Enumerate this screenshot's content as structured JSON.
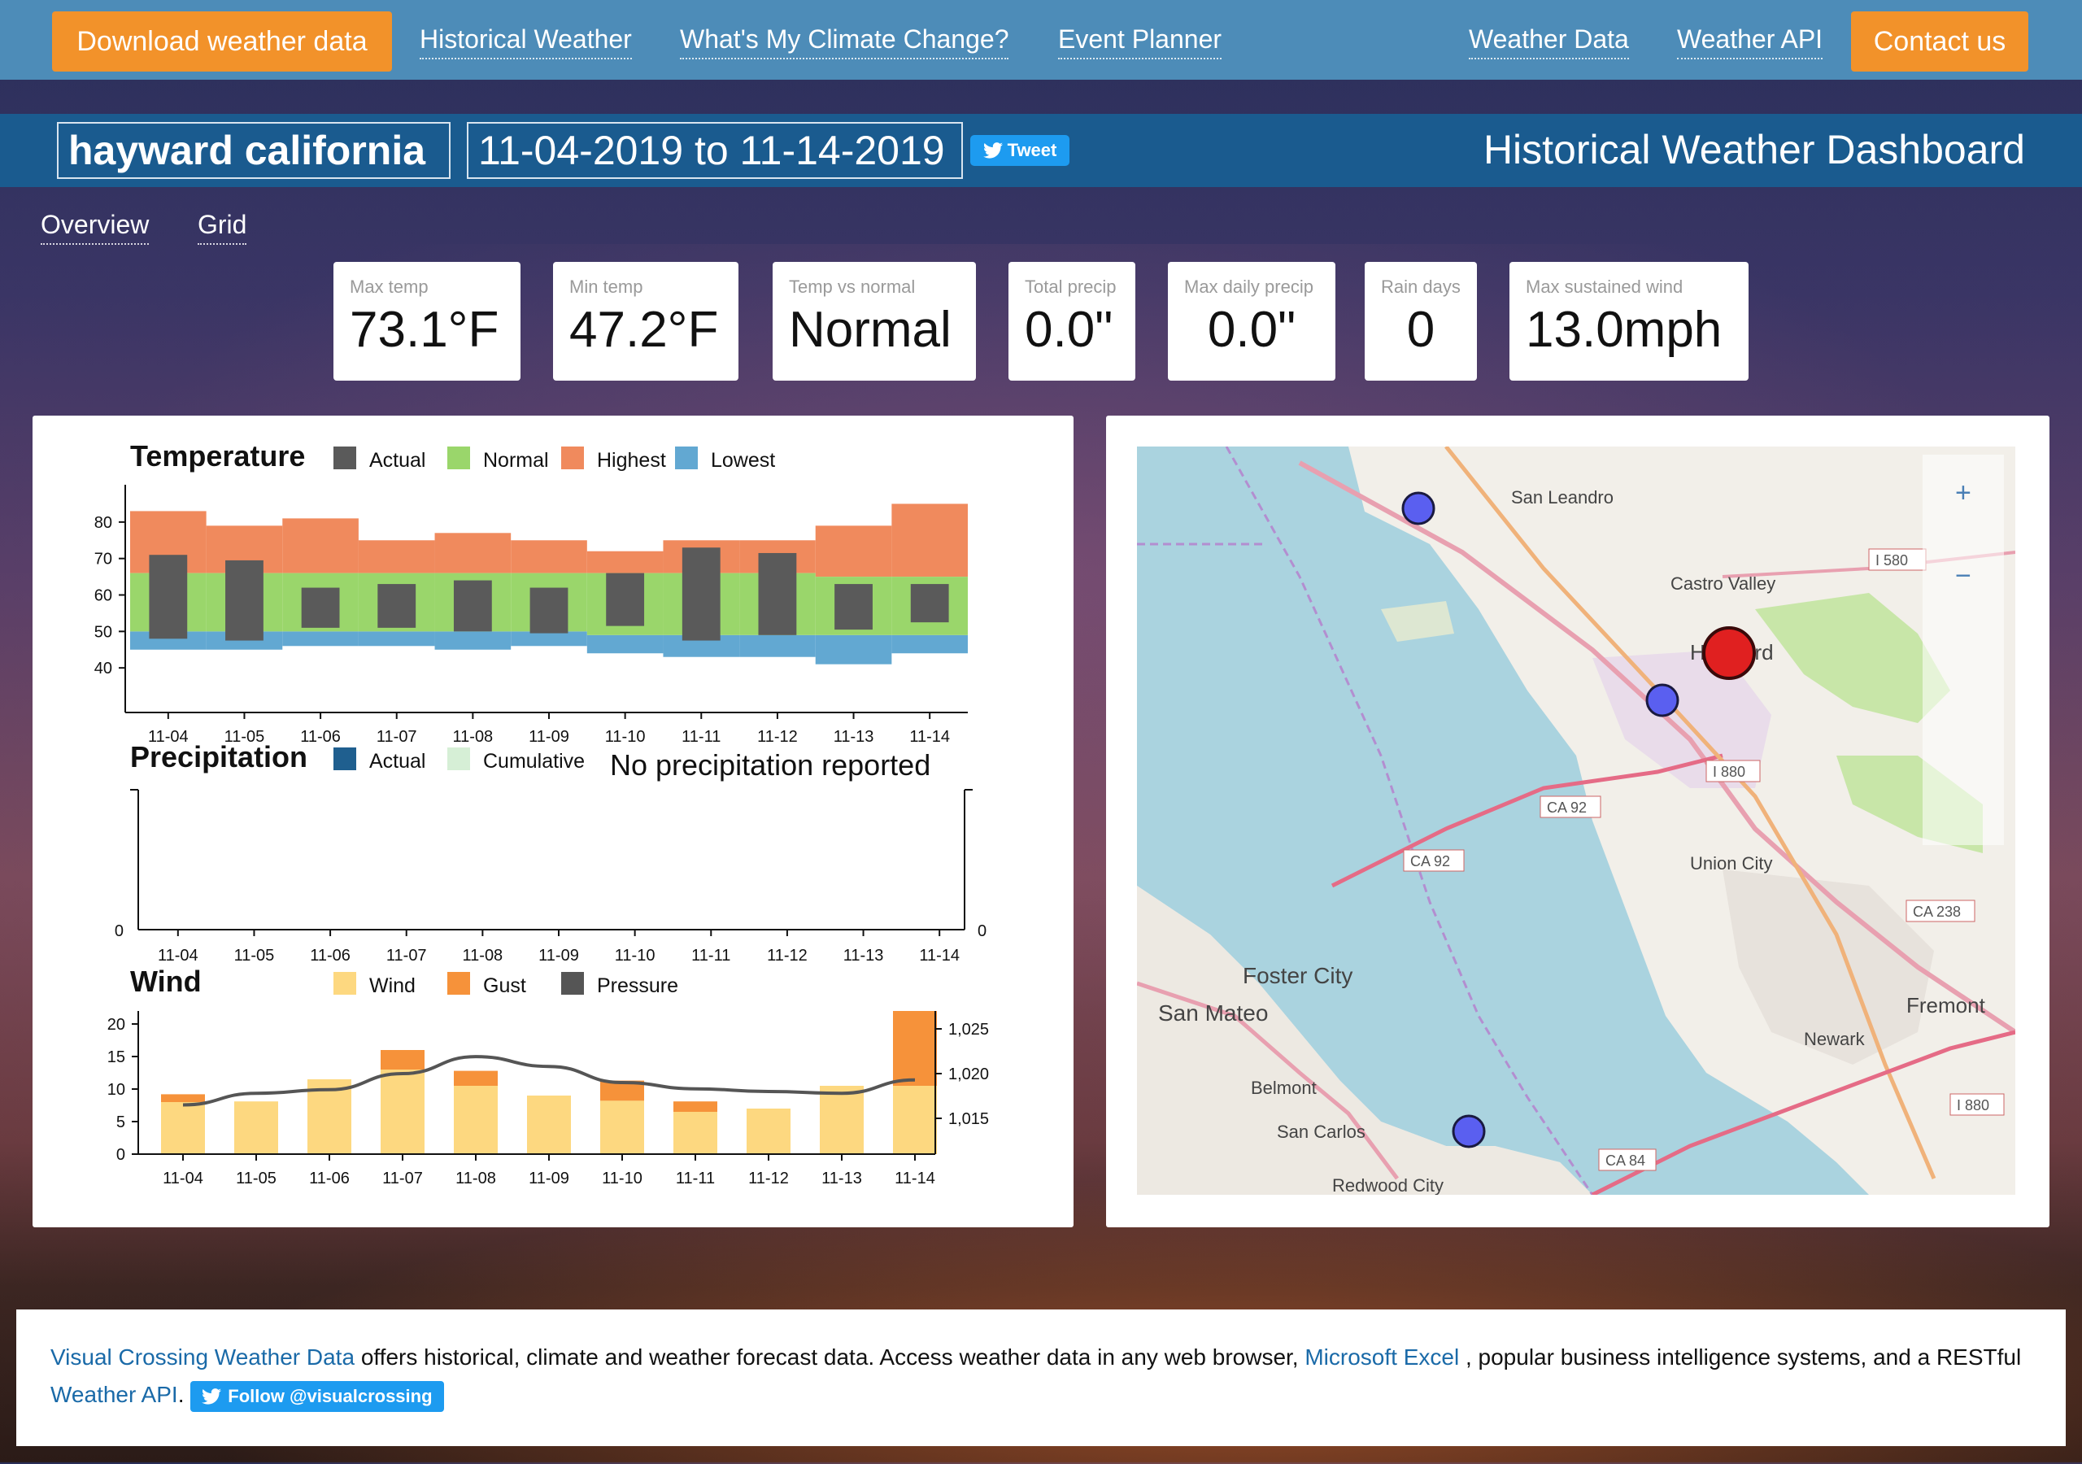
{
  "nav": {
    "download_btn": "Download weather data",
    "historical": "Historical Weather",
    "climate": "What's My Climate Change?",
    "planner": "Event Planner",
    "weather_data": "Weather Data",
    "weather_api": "Weather API",
    "contact_btn": "Contact us"
  },
  "header": {
    "location": "hayward california",
    "date_range": "11-04-2019 to 11-14-2019",
    "tweet": "Tweet",
    "title": "Historical Weather Dashboard"
  },
  "tabs": {
    "overview": "Overview",
    "grid": "Grid"
  },
  "stats": [
    {
      "label": "Max temp",
      "value": "73.1°F"
    },
    {
      "label": "Min temp",
      "value": "47.2°F"
    },
    {
      "label": "Temp vs normal",
      "value": "Normal"
    },
    {
      "label": "Total precip",
      "value": "0.0\""
    },
    {
      "label": "Max daily precip",
      "value": "0.0\""
    },
    {
      "label": "Rain days",
      "value": "0"
    },
    {
      "label": "Max sustained wind",
      "value": "13.0mph"
    }
  ],
  "colors": {
    "actual": "#5a5a5a",
    "normal": "#9ad66b",
    "highest": "#f08a5d",
    "lowest": "#62a8d2",
    "precip_actual": "#1f5f8f",
    "precip_cumulative": "#d6efd6",
    "wind": "#fdd880",
    "gust": "#f6923a",
    "pressure": "#555555"
  },
  "chart_data": [
    {
      "type": "bar",
      "title": "Temperature",
      "legend": [
        "Actual",
        "Normal",
        "Highest",
        "Lowest"
      ],
      "categories": [
        "11-04",
        "11-05",
        "11-06",
        "11-07",
        "11-08",
        "11-09",
        "11-10",
        "11-11",
        "11-12",
        "11-13",
        "11-14"
      ],
      "yticks": [
        40,
        50,
        60,
        70,
        80
      ],
      "ylim": [
        30,
        88
      ],
      "series": [
        {
          "name": "Highest",
          "low": [
            66,
            66,
            66,
            66,
            66,
            66,
            66,
            66,
            66,
            65,
            65
          ],
          "high": [
            83,
            79,
            81,
            75,
            77,
            75,
            72,
            75,
            75,
            79,
            85
          ]
        },
        {
          "name": "Lowest",
          "low": [
            45,
            45,
            46,
            46,
            45,
            46,
            44,
            43,
            43,
            41,
            44
          ],
          "high": [
            50,
            50,
            50,
            50,
            50,
            50,
            49,
            49,
            49,
            49,
            49
          ]
        },
        {
          "name": "Normal",
          "low": [
            50,
            50,
            50,
            50,
            50,
            50,
            49,
            49,
            49,
            49,
            49
          ],
          "high": [
            66,
            66,
            66,
            66,
            66,
            66,
            66,
            66,
            66,
            65,
            65
          ]
        },
        {
          "name": "Actual",
          "low": [
            48,
            47.5,
            51,
            51,
            50,
            49.5,
            51.5,
            47.5,
            49,
            50.5,
            52.5
          ],
          "high": [
            71,
            69.5,
            62,
            63,
            64,
            62,
            66,
            73,
            71.5,
            63,
            63
          ]
        }
      ]
    },
    {
      "type": "bar",
      "title": "Precipitation",
      "legend": [
        "Actual",
        "Cumulative"
      ],
      "note": "No precipitation reported",
      "categories": [
        "11-04",
        "11-05",
        "11-06",
        "11-07",
        "11-08",
        "11-09",
        "11-10",
        "11-11",
        "11-12",
        "11-13",
        "11-14"
      ],
      "values": [
        0,
        0,
        0,
        0,
        0,
        0,
        0,
        0,
        0,
        0,
        0
      ],
      "yticks_left": [
        0
      ],
      "yticks_right": [
        0
      ]
    },
    {
      "type": "bar",
      "title": "Wind",
      "legend": [
        "Wind",
        "Gust",
        "Pressure"
      ],
      "categories": [
        "11-04",
        "11-05",
        "11-06",
        "11-07",
        "11-08",
        "11-09",
        "11-10",
        "11-11",
        "11-12",
        "11-13",
        "11-14"
      ],
      "yticks": [
        0,
        5,
        10,
        15,
        20
      ],
      "ylim": [
        0,
        22
      ],
      "yticks_right": [
        "1,015",
        "1,020",
        "1,025"
      ],
      "y2lim": [
        1011,
        1027
      ],
      "series": [
        {
          "name": "Wind",
          "values": [
            8,
            8.1,
            11.5,
            13,
            10.5,
            9,
            8.2,
            6.5,
            7,
            10.5,
            10.5
          ]
        },
        {
          "name": "Gust",
          "values": [
            9.2,
            0,
            0,
            16,
            12.8,
            0,
            11.3,
            8.1,
            0,
            0,
            22
          ]
        },
        {
          "name": "Pressure",
          "values": [
            1016.5,
            1017.8,
            1018.2,
            1020,
            1021.9,
            1020.8,
            1019,
            1018.3,
            1018,
            1017.8,
            1019.3
          ]
        }
      ]
    }
  ],
  "map": {
    "zoom_in": "+",
    "zoom_out": "−",
    "labels": [
      "San Leandro",
      "Castro Valley",
      "Hayward",
      "Union City",
      "Fremont",
      "Newark",
      "Foster City",
      "San Mateo",
      "Belmont",
      "San Carlos",
      "Redwood City"
    ],
    "road_labels": [
      "I 580",
      "CA 92",
      "CA 92",
      "I 880",
      "CA 238",
      "I 880",
      "CA 84"
    ]
  },
  "footer": {
    "link1": "Visual Crossing Weather Data",
    "text1": " offers historical, climate and weather forecast data.   Access weather data in any web browser, ",
    "link2": "Microsoft Excel",
    "text2": " , popular business intelligence systems, and a RESTful ",
    "link3": "Weather API",
    "text3": ".",
    "follow": "Follow @visualcrossing"
  }
}
